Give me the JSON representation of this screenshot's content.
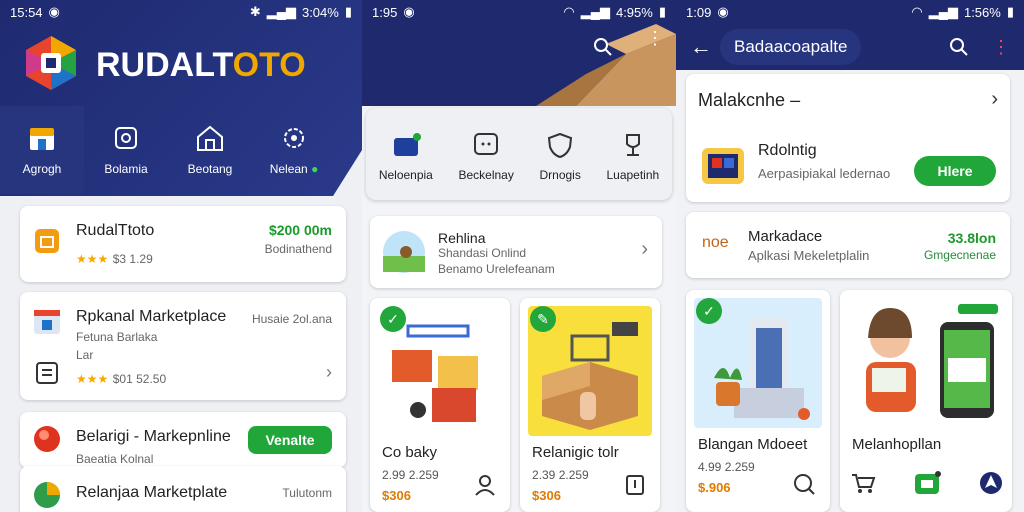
{
  "screen1": {
    "status": {
      "time": "15:54",
      "battery": "3:04%"
    },
    "brand": {
      "part1": "RUDALT",
      "part2": "OTO"
    },
    "categories": [
      {
        "label": "Agrogh",
        "icon": "store-icon"
      },
      {
        "label": "Bolamia",
        "icon": "badge-icon"
      },
      {
        "label": "Beotang",
        "icon": "house-icon"
      },
      {
        "label": "Nelean",
        "icon": "gear-icon"
      }
    ],
    "card1": {
      "title": "RudalTtoto",
      "price": "$200 00m",
      "sub": "Bodinathend",
      "rating": "$3 1.29"
    },
    "card2": {
      "title": "Rpkanal Marketplace",
      "side": "Husaie 2ol.ana",
      "line1": "Fetuna Barlaka",
      "line2": "Lar",
      "rating": "$01 52.50"
    },
    "card3": {
      "title": "Belarigi - Markepnline",
      "sub": "Baeatia Kolnal",
      "button": "Venalte"
    },
    "card4": {
      "title": "Relanjaa Marketplate",
      "side": "Tulutonm"
    }
  },
  "screen2": {
    "status": {
      "time": "1:95",
      "battery": "4:95%"
    },
    "categories": [
      {
        "label": "Neloenpia",
        "icon": "bag-icon"
      },
      {
        "label": "Beckelnay",
        "icon": "chat-icon"
      },
      {
        "label": "Drnogis",
        "icon": "shield-icon"
      },
      {
        "label": "Luapetinh",
        "icon": "trophy-icon"
      }
    ],
    "banner": {
      "title": "Rehlina",
      "line1": "Shandasi Onlind",
      "line2": "Benamo Urelefeanam"
    },
    "products": [
      {
        "name": "Co baky",
        "num": "2.99 2.259",
        "price": "$306"
      },
      {
        "name": "Relanigic tolr",
        "num": "2.39 2.259",
        "price": "$306"
      }
    ]
  },
  "screen3": {
    "status": {
      "time": "1:09",
      "battery": "1:56%"
    },
    "appbar_title": "Badaacoapalte",
    "card1": {
      "title": "Malakcnhe",
      "dash": "–",
      "name": "Rdolntig",
      "sub": "Aerpasipiakal ledernao",
      "button": "Hlere"
    },
    "card2": {
      "prefix": "noe",
      "title": "Markadace",
      "sub": "Aplkasi Mekeletplalin",
      "price": "33.8lon",
      "price_sub": "Gmgecnenae"
    },
    "products": [
      {
        "name": "Blangan Mdoeet",
        "num": "4.99 2.259",
        "price": "$.906"
      },
      {
        "name": "Melanhopllan",
        "num": "",
        "price": ""
      }
    ]
  },
  "colors": {
    "navy": "#1f2a6e",
    "green": "#21a639",
    "orange": "#f0a800"
  }
}
